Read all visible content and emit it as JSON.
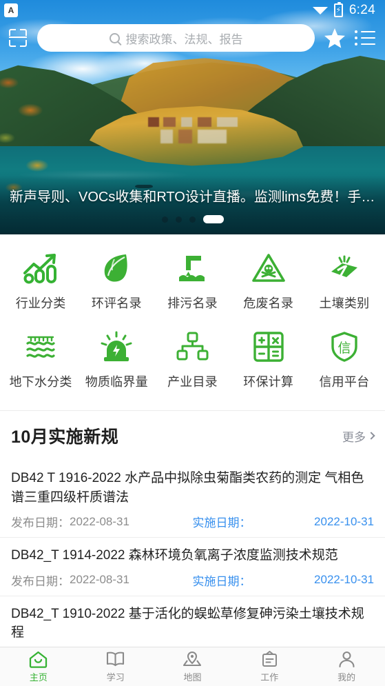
{
  "theme": {
    "accent_green": "#35b233",
    "link_blue": "#3890ee",
    "status_bg": "#1f8bdc"
  },
  "status_bar": {
    "notification_icon": "app-notification-a-icon",
    "notification_letter": "A",
    "wifi_icon": "wifi-signal-icon",
    "battery_icon": "battery-charging-icon",
    "battery_glyph": "⚡",
    "time": "6:24"
  },
  "header": {
    "scan_icon": "scan-qr-icon",
    "star_icon": "star-favorite-icon",
    "menu_icon": "list-menu-icon",
    "search": {
      "placeholder": "搜索政策、法规、报告",
      "value": "",
      "icon": "search-icon"
    }
  },
  "banner": {
    "caption": "新声导则、VOCs收集和RTO设计直播。监测lims免费！手…",
    "dot_count": 4,
    "active_dot_index": 3,
    "image_alt": "秋色山村湖泊风景"
  },
  "grid": {
    "rows": [
      [
        {
          "label": "行业分类",
          "icon": "bar-chart-growth-icon"
        },
        {
          "label": "环评名录",
          "icon": "leaf-icon"
        },
        {
          "label": "排污名录",
          "icon": "discharge-pipe-icon"
        },
        {
          "label": "危废名录",
          "icon": "hazard-skull-triangle-icon"
        },
        {
          "label": "土壤类别",
          "icon": "soil-plot-icon"
        }
      ],
      [
        {
          "label": "地下水分类",
          "icon": "groundwater-waves-icon"
        },
        {
          "label": "物质临界量",
          "icon": "alarm-siren-bolt-icon"
        },
        {
          "label": "产业目录",
          "icon": "hierarchy-tree-icon"
        },
        {
          "label": "环保计算",
          "icon": "calculator-icon"
        },
        {
          "label": "信用平台",
          "icon": "shield-credit-icon"
        }
      ]
    ]
  },
  "section": {
    "title": "10月实施新规",
    "more_label": "更多",
    "more_icon": "chevron-right-icon"
  },
  "list": {
    "publish_label": "发布日期：",
    "effective_label": "实施日期：",
    "items": [
      {
        "title": "DB42 T 1916-2022 水产品中拟除虫菊酯类农药的测定 气相色谱三重四级杆质谱法",
        "publish_date": "2022-08-31",
        "effective_date": "2022-10-31",
        "show_meta": true
      },
      {
        "title": "DB42_T 1914-2022 森林环境负氧离子浓度监测技术规范",
        "publish_date": "2022-08-31",
        "effective_date": "2022-10-31",
        "show_meta": true
      },
      {
        "title": "DB42_T 1910-2022 基于活化的蜈蚣草修复砷污染土壤技术规程",
        "publish_date": "",
        "effective_date": "",
        "show_meta": false
      }
    ]
  },
  "tabbar": {
    "items": [
      {
        "label": "主页",
        "icon": "home-icon",
        "active": true
      },
      {
        "label": "学习",
        "icon": "book-icon",
        "active": false
      },
      {
        "label": "地图",
        "icon": "map-pin-icon",
        "active": false
      },
      {
        "label": "工作",
        "icon": "clipboard-work-icon",
        "active": false
      },
      {
        "label": "我的",
        "icon": "user-profile-icon",
        "active": false
      }
    ]
  }
}
